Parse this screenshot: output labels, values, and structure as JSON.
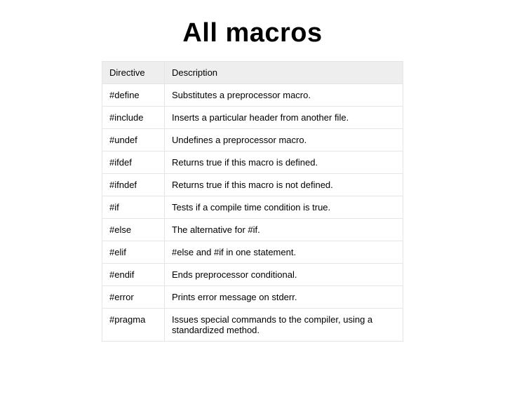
{
  "title": "All macros",
  "table": {
    "headers": {
      "directive": "Directive",
      "description": "Description"
    },
    "rows": [
      {
        "directive": "#define",
        "description": "Substitutes a preprocessor macro."
      },
      {
        "directive": "#include",
        "description": "Inserts a particular header from another file."
      },
      {
        "directive": "#undef",
        "description": "Undefines a preprocessor macro."
      },
      {
        "directive": "#ifdef",
        "description": "Returns true if this macro is defined."
      },
      {
        "directive": "#ifndef",
        "description": "Returns true if this macro is not defined."
      },
      {
        "directive": "#if",
        "description": "Tests if a compile time condition is true."
      },
      {
        "directive": "#else",
        "description": "The alternative for #if."
      },
      {
        "directive": "#elif",
        "description": "#else and #if in one statement."
      },
      {
        "directive": "#endif",
        "description": "Ends preprocessor conditional."
      },
      {
        "directive": "#error",
        "description": "Prints error message on stderr."
      },
      {
        "directive": "#pragma",
        "description": "Issues special commands to the compiler, using a standardized method."
      }
    ]
  }
}
